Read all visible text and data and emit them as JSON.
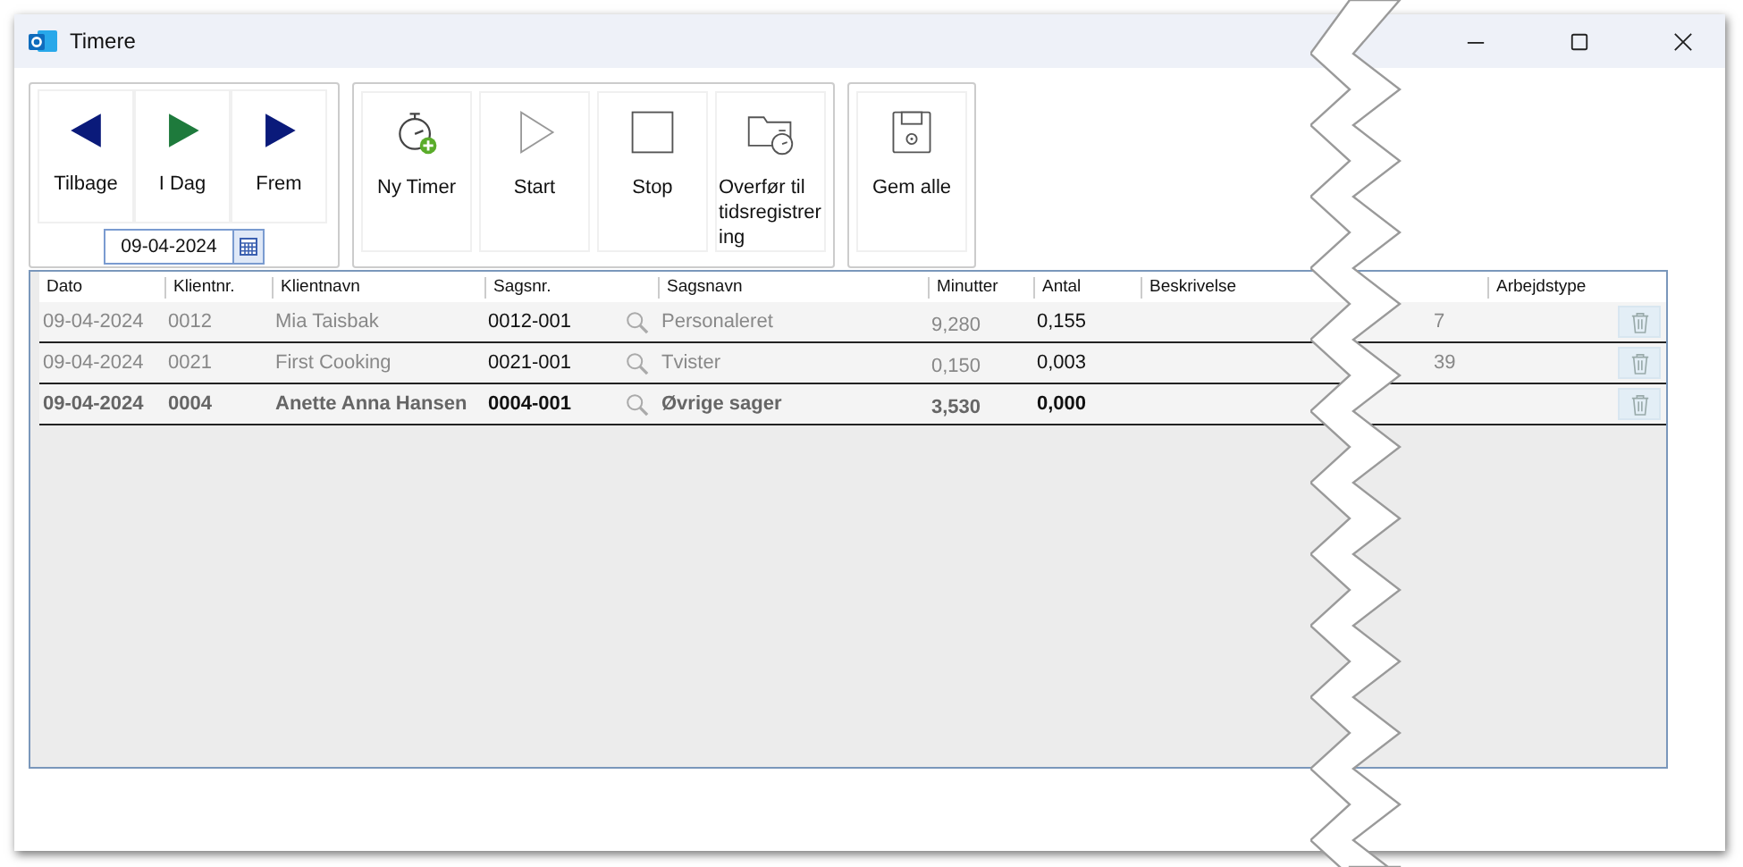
{
  "window": {
    "title": "Timere"
  },
  "navigation": {
    "buttons": [
      {
        "kind": "back",
        "label": "Tilbage"
      },
      {
        "kind": "today",
        "label": "I Dag"
      },
      {
        "kind": "forward",
        "label": "Frem"
      }
    ],
    "date": {
      "value": "09-04-2024"
    }
  },
  "actions": [
    {
      "kind": "new-timer",
      "label": "Ny Timer"
    },
    {
      "kind": "start",
      "label": "Start"
    },
    {
      "kind": "stop",
      "label": "Stop"
    },
    {
      "kind": "transfer",
      "label": "Overfør til tidsregistrering"
    }
  ],
  "save": {
    "kind": "save",
    "label": "Gem alle"
  },
  "table": {
    "columns": [
      "Dato",
      "Klientnr.",
      "Klientnavn",
      "Sagsnr.",
      "Sagsnavn",
      "Minutter",
      "Antal",
      "Beskrivelse",
      "Arbejdstype"
    ],
    "rows": [
      {
        "bold": false,
        "dato": "09-04-2024",
        "klientnr": "0012",
        "klientnavn": "Mia Taisbak",
        "sagsnr": "0012-001",
        "sagsnavn": "Personaleret",
        "minutter": "9,280",
        "antal": "0,155",
        "column_10": "7"
      },
      {
        "bold": false,
        "dato": "09-04-2024",
        "klientnr": "0021",
        "klientnavn": "First Cooking",
        "sagsnr": "0021-001",
        "sagsnavn": "Tvister",
        "minutter": "0,150",
        "antal": "0,003",
        "column_10": "39"
      },
      {
        "bold": true,
        "dato": "09-04-2024",
        "klientnr": "0004",
        "klientnavn": "Anette Anna Hansen",
        "sagsnr": "0004-001",
        "sagsnavn": "Øvrige sager",
        "minutter": "3,530",
        "antal": "0,000"
      }
    ]
  }
}
